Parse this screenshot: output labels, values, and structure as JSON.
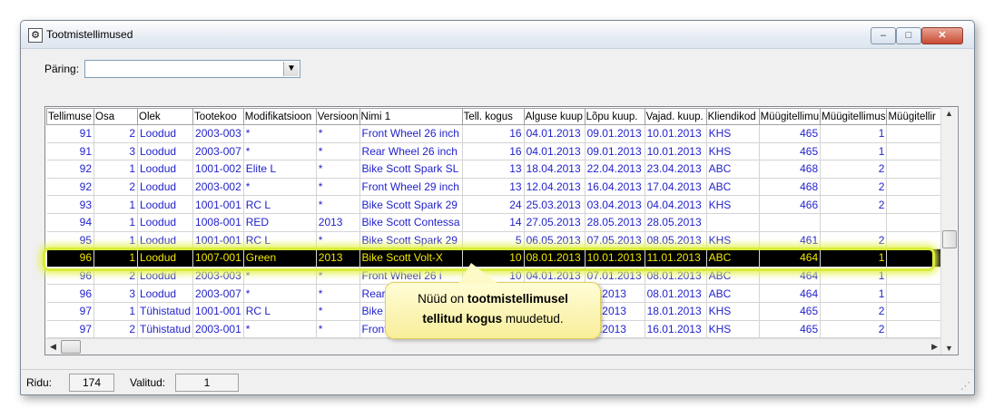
{
  "window": {
    "title": "Tootmistellimused",
    "min_glyph": "–",
    "max_glyph": "□",
    "close_glyph": "✕"
  },
  "query": {
    "label": "Päring:",
    "value": ""
  },
  "table": {
    "columns": [
      "Tellimuse",
      "Osa",
      "Olek",
      "Tootekoo",
      "Modifikatsioon",
      "Versioon",
      "Nimi 1",
      "Tell. kogus",
      "Alguse kuup",
      "Lõpu kuup.",
      "Vajad. kuup.",
      "Kliendikod",
      "Müügitellimu",
      "Müügitellimus",
      "Müügitellir"
    ],
    "rows": [
      [
        "91",
        "2",
        "Loodud",
        "2003-003",
        "*",
        "*",
        "Front Wheel 26 inch",
        "16",
        "04.01.2013",
        "09.01.2013",
        "10.01.2013",
        "KHS",
        "465",
        "1",
        ""
      ],
      [
        "91",
        "3",
        "Loodud",
        "2003-007",
        "*",
        "*",
        "Rear Wheel 26 inch",
        "16",
        "04.01.2013",
        "09.01.2013",
        "10.01.2013",
        "KHS",
        "465",
        "1",
        ""
      ],
      [
        "92",
        "1",
        "Loodud",
        "1001-002",
        "Elite L",
        "*",
        "Bike Scott Spark SL",
        "13",
        "18.04.2013",
        "22.04.2013",
        "23.04.2013",
        "ABC",
        "468",
        "2",
        ""
      ],
      [
        "92",
        "2",
        "Loodud",
        "2003-002",
        "*",
        "*",
        "Front Wheel 29 inch",
        "13",
        "12.04.2013",
        "16.04.2013",
        "17.04.2013",
        "ABC",
        "468",
        "2",
        ""
      ],
      [
        "93",
        "1",
        "Loodud",
        "1001-001",
        "RC L",
        "*",
        "Bike Scott Spark 29",
        "24",
        "25.03.2013",
        "03.04.2013",
        "04.04.2013",
        "KHS",
        "466",
        "2",
        ""
      ],
      [
        "94",
        "1",
        "Loodud",
        "1008-001",
        "RED",
        "2013",
        "Bike Scott Contessa",
        "14",
        "27.05.2013",
        "28.05.2013",
        "28.05.2013",
        "",
        "",
        "",
        ""
      ],
      [
        "95",
        "1",
        "Loodud",
        "1001-001",
        "RC L",
        "*",
        "Bike Scott Spark 29",
        "5",
        "06.05.2013",
        "07.05.2013",
        "08.05.2013",
        "KHS",
        "461",
        "2",
        ""
      ],
      [
        "96",
        "1",
        "Loodud",
        "1007-001",
        "Green",
        "2013",
        "Bike Scott Volt-X",
        "10",
        "08.01.2013",
        "10.01.2013",
        "11.01.2013",
        "ABC",
        "464",
        "1",
        ""
      ],
      [
        "96",
        "2",
        "Loodud",
        "2003-003",
        "*",
        "*",
        "Front Wheel 26 i",
        "10",
        "04.01.2013",
        "07.01.2013",
        "08.01.2013",
        "ABC",
        "464",
        "1",
        ""
      ],
      [
        "96",
        "3",
        "Loodud",
        "2003-007",
        "*",
        "*",
        "Rear",
        "",
        "",
        "01.2013",
        "08.01.2013",
        "ABC",
        "464",
        "1",
        ""
      ],
      [
        "97",
        "1",
        "Tühistatud",
        "1001-001",
        "RC L",
        "*",
        "Bike",
        "",
        "",
        "01.2013",
        "18.01.2013",
        "KHS",
        "465",
        "2",
        ""
      ],
      [
        "97",
        "2",
        "Tühistatud",
        "2003-001",
        "*",
        "*",
        "Front",
        "",
        "",
        "01.2013",
        "16.01.2013",
        "KHS",
        "465",
        "2",
        ""
      ]
    ],
    "selected_row_index": 7
  },
  "status": {
    "rows_label": "Ridu:",
    "rows_value": "174",
    "selected_label": "Valitud:",
    "selected_value": "1"
  },
  "callout": {
    "line1_prefix": "Nüüd on ",
    "line1_bold": "tootmistellimusel",
    "line2_bold": "tellitud kogus",
    "line2_suffix": " muudetud."
  },
  "colors": {
    "link_text": "#1f1fcc",
    "selected_bg": "#000000",
    "selected_text": "#f2e800",
    "highlight": "#d9ec3b"
  }
}
